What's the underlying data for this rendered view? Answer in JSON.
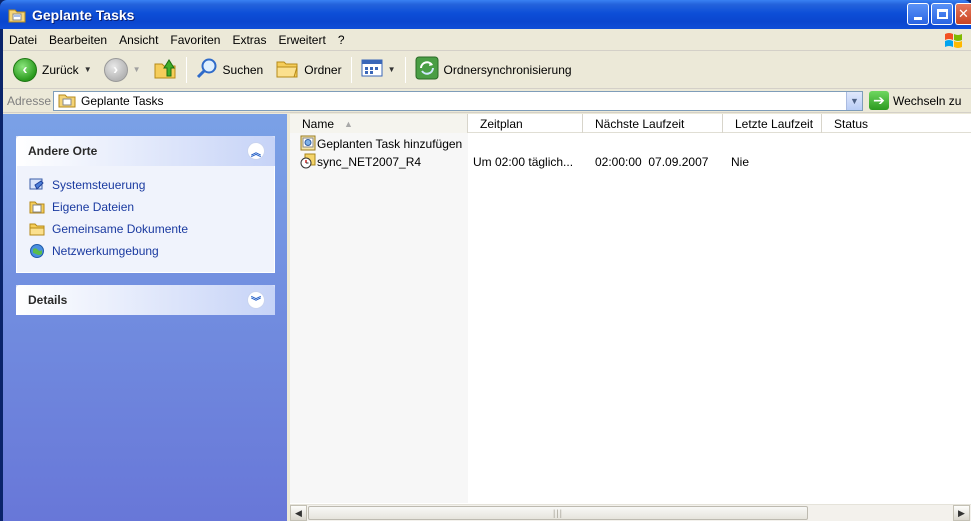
{
  "window": {
    "title": "Geplante Tasks"
  },
  "menu": {
    "items": [
      "Datei",
      "Bearbeiten",
      "Ansicht",
      "Favoriten",
      "Extras",
      "Erweitert",
      "?"
    ]
  },
  "toolbar": {
    "back_label": "Zurück",
    "search_label": "Suchen",
    "folders_label": "Ordner",
    "sync_label": "Ordnersynchronisierung"
  },
  "address": {
    "label": "Adresse",
    "value": "Geplante Tasks",
    "go_label": "Wechseln zu"
  },
  "sidebar": {
    "other_places": {
      "title": "Andere Orte",
      "items": [
        {
          "label": "Systemsteuerung",
          "icon": "control-panel-icon"
        },
        {
          "label": "Eigene Dateien",
          "icon": "my-documents-icon"
        },
        {
          "label": "Gemeinsame Dokumente",
          "icon": "shared-documents-icon"
        },
        {
          "label": "Netzwerkumgebung",
          "icon": "network-icon"
        }
      ]
    },
    "details": {
      "title": "Details"
    }
  },
  "list": {
    "columns": [
      "Name",
      "Zeitplan",
      "Nächste Laufzeit",
      "Letzte Laufzeit",
      "Status"
    ],
    "rows": [
      {
        "name": "Geplanten Task hinzufügen",
        "schedule": "",
        "next_run": "",
        "last_run": "",
        "status": "",
        "icon": "add-task-icon"
      },
      {
        "name": "sync_NET2007_R4",
        "schedule": "Um 02:00 täglich...",
        "next_run": "02:00:00  07.09.2007",
        "last_run": "Nie",
        "status": "",
        "icon": "scheduled-task-icon"
      }
    ]
  },
  "colors": {
    "titlebar": "#0a46cf",
    "sidebar_bg": "#d6dff7",
    "link_text": "#1a3aa0"
  }
}
